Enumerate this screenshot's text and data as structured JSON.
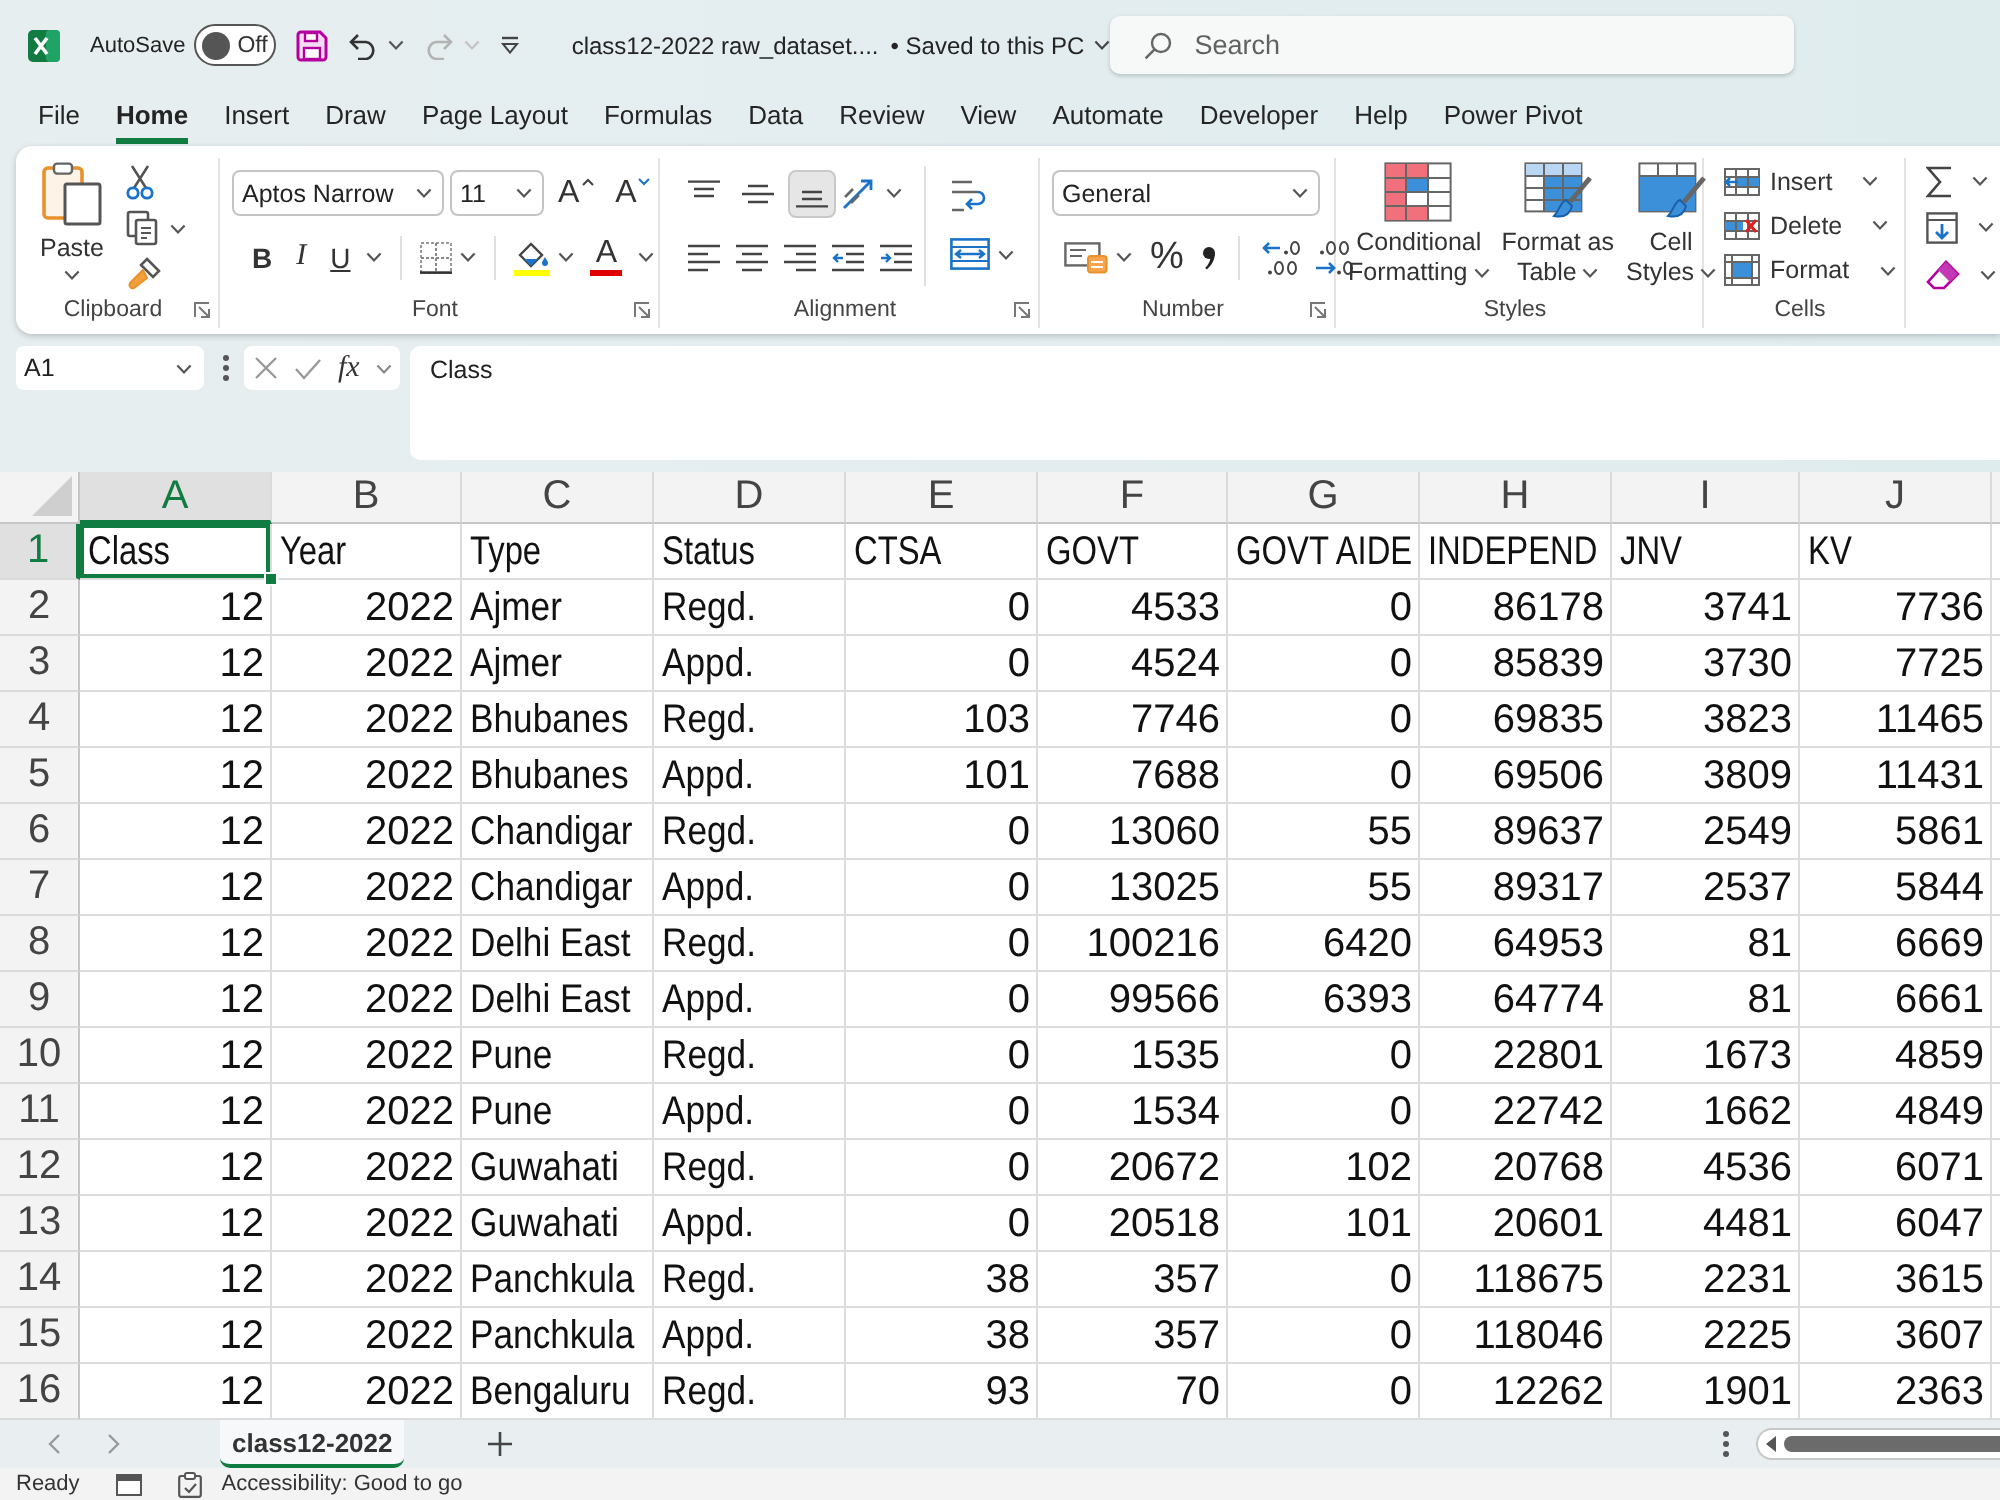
{
  "title_bar": {
    "autosave_label": "AutoSave",
    "autosave_toggle": {
      "label": "Off",
      "on": false
    },
    "quick_access": [
      {
        "kind": "save",
        "disabled": false
      },
      {
        "kind": "undo",
        "disabled": false
      },
      {
        "kind": "redo",
        "disabled": true
      },
      {
        "kind": "customize",
        "disabled": false
      }
    ],
    "document_title": "class12-2022 raw_dataset....",
    "save_status": "• Saved to this PC",
    "search": {
      "placeholder": "Search"
    }
  },
  "ribbon_tabs": [
    {
      "label": "File",
      "selected": false
    },
    {
      "label": "Home",
      "selected": true
    },
    {
      "label": "Insert",
      "selected": false
    },
    {
      "label": "Draw",
      "selected": false
    },
    {
      "label": "Page Layout",
      "selected": false
    },
    {
      "label": "Formulas",
      "selected": false
    },
    {
      "label": "Data",
      "selected": false
    },
    {
      "label": "Review",
      "selected": false
    },
    {
      "label": "View",
      "selected": false
    },
    {
      "label": "Automate",
      "selected": false
    },
    {
      "label": "Developer",
      "selected": false
    },
    {
      "label": "Help",
      "selected": false
    },
    {
      "label": "Power Pivot",
      "selected": false
    }
  ],
  "ribbon": {
    "groups": [
      {
        "kind": "clipboard",
        "label": "Clipboard",
        "launcher": true,
        "paste_label": "Paste"
      },
      {
        "kind": "font",
        "label": "Font",
        "launcher": true,
        "font_name": "Aptos Narrow",
        "font_size": "11",
        "grow_label": "A",
        "shrink_label": "A",
        "bold_label": "B",
        "italic_label": "I",
        "underline_label": "U",
        "font_color_label": "A"
      },
      {
        "kind": "alignment",
        "label": "Alignment",
        "launcher": true,
        "vertical": [
          {
            "kind": "top",
            "selected": false
          },
          {
            "kind": "middle",
            "selected": false
          },
          {
            "kind": "bottom",
            "selected": true
          }
        ],
        "horizontal": [
          {
            "kind": "left"
          },
          {
            "kind": "center"
          },
          {
            "kind": "right"
          },
          {
            "kind": "outdent"
          },
          {
            "kind": "indent"
          }
        ]
      },
      {
        "kind": "number",
        "label": "Number",
        "launcher": true,
        "format": "General",
        "percent_label": "%"
      },
      {
        "kind": "styles",
        "label": "Styles",
        "launcher": false,
        "buttons": [
          {
            "kind": "conditional",
            "label": "Conditional\nFormatting"
          },
          {
            "kind": "table",
            "label": "Format as\nTable"
          },
          {
            "kind": "cell_styles",
            "label": "Cell\nStyles"
          }
        ]
      },
      {
        "kind": "cells",
        "label": "Cells",
        "launcher": false,
        "buttons": [
          {
            "kind": "insert",
            "label": "Insert"
          },
          {
            "kind": "delete",
            "label": "Delete"
          },
          {
            "kind": "format",
            "label": "Format"
          }
        ]
      },
      {
        "kind": "editing",
        "buttons": [
          {
            "kind": "sum"
          },
          {
            "kind": "fill"
          },
          {
            "kind": "clear"
          }
        ]
      }
    ]
  },
  "formula_bar": {
    "name_box": "A1",
    "function_label": "fx",
    "formula": "Class"
  },
  "sheet": {
    "columns": [
      {
        "letter": "A",
        "kind": "number",
        "selected": true
      },
      {
        "letter": "B",
        "kind": "number",
        "selected": false
      },
      {
        "letter": "C",
        "kind": "text",
        "selected": false
      },
      {
        "letter": "D",
        "kind": "text",
        "selected": false
      },
      {
        "letter": "E",
        "kind": "number",
        "selected": false
      },
      {
        "letter": "F",
        "kind": "number",
        "selected": false
      },
      {
        "letter": "G",
        "kind": "number",
        "selected": false
      },
      {
        "letter": "H",
        "kind": "number",
        "selected": false
      },
      {
        "letter": "I",
        "kind": "number",
        "selected": false
      },
      {
        "letter": "J",
        "kind": "number",
        "selected": false
      }
    ],
    "rows": [
      {
        "header": "1",
        "kind": "labels",
        "selected": true,
        "cells": [
          "Class",
          "Year",
          "Type",
          "Status",
          "CTSA",
          "GOVT",
          "GOVT AIDE",
          "INDEPEND",
          "JNV",
          "KV"
        ]
      },
      {
        "header": "2",
        "kind": "data",
        "selected": false,
        "cells": [
          "12",
          "2022",
          "Ajmer",
          "Regd.",
          "0",
          "4533",
          "0",
          "86178",
          "3741",
          "7736"
        ]
      },
      {
        "header": "3",
        "kind": "data",
        "selected": false,
        "cells": [
          "12",
          "2022",
          "Ajmer",
          "Appd.",
          "0",
          "4524",
          "0",
          "85839",
          "3730",
          "7725"
        ]
      },
      {
        "header": "4",
        "kind": "data",
        "selected": false,
        "cells": [
          "12",
          "2022",
          "Bhubanes",
          "Regd.",
          "103",
          "7746",
          "0",
          "69835",
          "3823",
          "11465"
        ]
      },
      {
        "header": "5",
        "kind": "data",
        "selected": false,
        "cells": [
          "12",
          "2022",
          "Bhubanes",
          "Appd.",
          "101",
          "7688",
          "0",
          "69506",
          "3809",
          "11431"
        ]
      },
      {
        "header": "6",
        "kind": "data",
        "selected": false,
        "cells": [
          "12",
          "2022",
          "Chandigar",
          "Regd.",
          "0",
          "13060",
          "55",
          "89637",
          "2549",
          "5861"
        ]
      },
      {
        "header": "7",
        "kind": "data",
        "selected": false,
        "cells": [
          "12",
          "2022",
          "Chandigar",
          "Appd.",
          "0",
          "13025",
          "55",
          "89317",
          "2537",
          "5844"
        ]
      },
      {
        "header": "8",
        "kind": "data",
        "selected": false,
        "cells": [
          "12",
          "2022",
          "Delhi East",
          "Regd.",
          "0",
          "100216",
          "6420",
          "64953",
          "81",
          "6669"
        ]
      },
      {
        "header": "9",
        "kind": "data",
        "selected": false,
        "cells": [
          "12",
          "2022",
          "Delhi East",
          "Appd.",
          "0",
          "99566",
          "6393",
          "64774",
          "81",
          "6661"
        ]
      },
      {
        "header": "10",
        "kind": "data",
        "selected": false,
        "cells": [
          "12",
          "2022",
          "Pune",
          "Regd.",
          "0",
          "1535",
          "0",
          "22801",
          "1673",
          "4859"
        ]
      },
      {
        "header": "11",
        "kind": "data",
        "selected": false,
        "cells": [
          "12",
          "2022",
          "Pune",
          "Appd.",
          "0",
          "1534",
          "0",
          "22742",
          "1662",
          "4849"
        ]
      },
      {
        "header": "12",
        "kind": "data",
        "selected": false,
        "cells": [
          "12",
          "2022",
          "Guwahati",
          "Regd.",
          "0",
          "20672",
          "102",
          "20768",
          "4536",
          "6071"
        ]
      },
      {
        "header": "13",
        "kind": "data",
        "selected": false,
        "cells": [
          "12",
          "2022",
          "Guwahati",
          "Appd.",
          "0",
          "20518",
          "101",
          "20601",
          "4481",
          "6047"
        ]
      },
      {
        "header": "14",
        "kind": "data",
        "selected": false,
        "cells": [
          "12",
          "2022",
          "Panchkula",
          "Regd.",
          "38",
          "357",
          "0",
          "118675",
          "2231",
          "3615"
        ]
      },
      {
        "header": "15",
        "kind": "data",
        "selected": false,
        "cells": [
          "12",
          "2022",
          "Panchkula",
          "Appd.",
          "38",
          "357",
          "0",
          "118046",
          "2225",
          "3607"
        ]
      },
      {
        "header": "16",
        "kind": "data",
        "selected": false,
        "cells": [
          "12",
          "2022",
          "Bengaluru",
          "Regd.",
          "93",
          "70",
          "0",
          "12262",
          "1901",
          "2363"
        ]
      }
    ]
  },
  "sheet_tabs": [
    {
      "label": "class12-2022",
      "selected": true
    }
  ],
  "status_bar": {
    "mode": "Ready",
    "accessibility": "Accessibility: Good to go"
  }
}
